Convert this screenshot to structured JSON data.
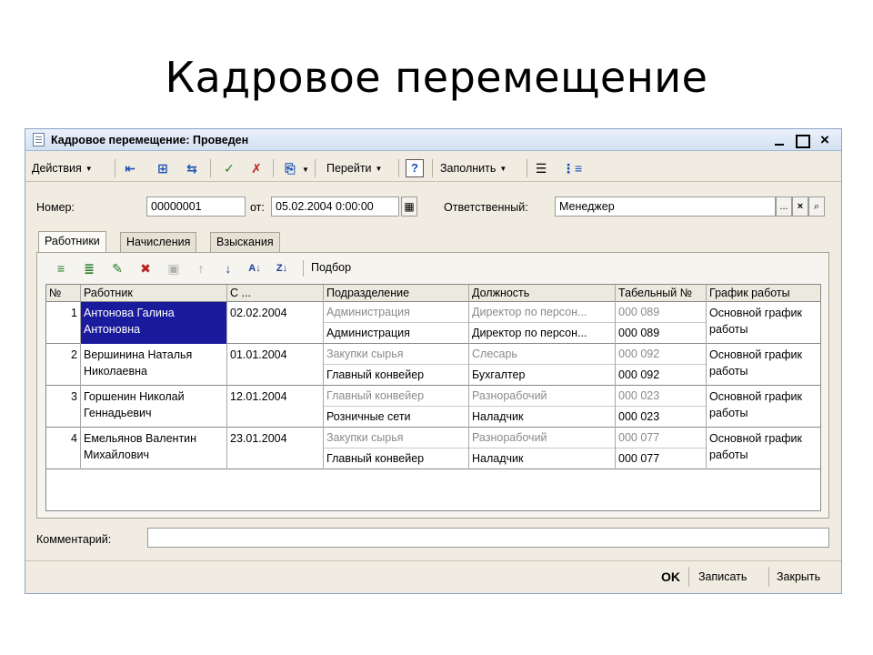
{
  "slide_title": "Кадровое перемещение",
  "window": {
    "title": "Кадровое перемещение: Проведен",
    "controls": {
      "close": "×"
    }
  },
  "toolbar": {
    "actions_label": "Действия",
    "goto_label": "Перейти",
    "help_label": "?",
    "fill_label": "Заполнить"
  },
  "form": {
    "number_label": "Номер:",
    "number_value": "00000001",
    "date_label": "от:",
    "date_value": "05.02.2004  0:00:00",
    "responsible_label": "Ответственный:",
    "responsible_value": "Менеджер",
    "ellipsis_button": "...",
    "clear_button": "×",
    "comment_label": "Комментарий:",
    "comment_value": ""
  },
  "tabs": [
    {
      "label": "Работники",
      "active": true
    },
    {
      "label": "Начисления",
      "active": false
    },
    {
      "label": "Взыскания",
      "active": false
    }
  ],
  "grid_toolbar": {
    "selection_label": "Подбор"
  },
  "grid": {
    "columns": [
      "№",
      "Работник",
      "С ...",
      "Подразделение",
      "Должность",
      "Табельный №",
      "График работы"
    ],
    "rows": [
      {
        "num": "1",
        "employee": "Антонова Галина Антоновна",
        "date": "02.02.2004",
        "dept_from": "Администрация",
        "dept_to": "Администрация",
        "pos_from": "Директор по персон...",
        "pos_to": "Директор по персон...",
        "tab_from": "000 089",
        "tab_to": "000 089",
        "schedule": "Основной график работы"
      },
      {
        "num": "2",
        "employee": "Вершинина Наталья Николаевна",
        "date": "01.01.2004",
        "dept_from": "Закупки сырья",
        "dept_to": "Главный конвейер",
        "pos_from": "Слесарь",
        "pos_to": "Бухгалтер",
        "tab_from": "000 092",
        "tab_to": "000 092",
        "schedule": "Основной график работы"
      },
      {
        "num": "3",
        "employee": "Горшенин Николай Геннадьевич",
        "date": "12.01.2004",
        "dept_from": "Главный конвейер",
        "dept_to": "Розничные сети",
        "pos_from": "Разнорабочий",
        "pos_to": "Наладчик",
        "tab_from": "000 023",
        "tab_to": "000 023",
        "schedule": "Основной график работы"
      },
      {
        "num": "4",
        "employee": "Емельянов Валентин Михайлович",
        "date": "23.01.2004",
        "dept_from": "Закупки сырья",
        "dept_to": "Главный конвейер",
        "pos_from": "Разнорабочий",
        "pos_to": "Наладчик",
        "tab_from": "000 077",
        "tab_to": "000 077",
        "schedule": "Основной график работы"
      }
    ]
  },
  "footer": {
    "ok_label": "OK",
    "save_label": "Записать",
    "close_label": "Закрыть"
  }
}
